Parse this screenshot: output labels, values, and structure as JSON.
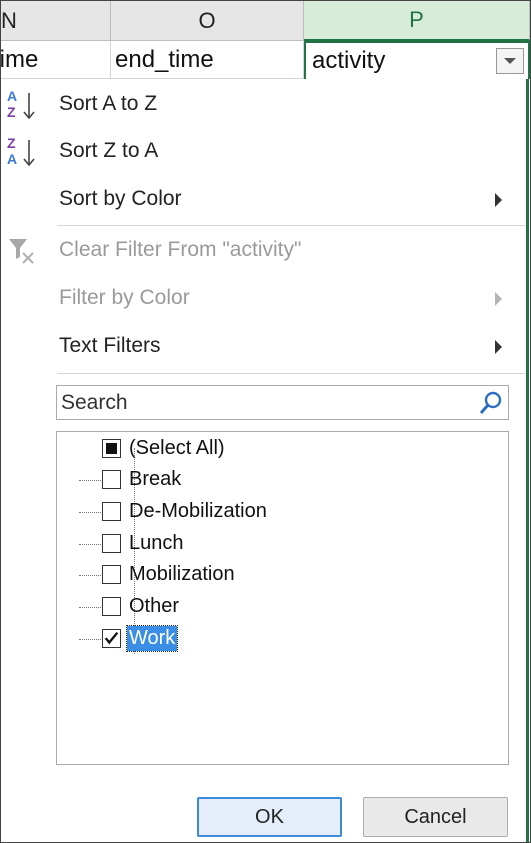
{
  "columns": [
    {
      "letter": "N",
      "header": "time"
    },
    {
      "letter": "O",
      "header": "end_time"
    },
    {
      "letter": "P",
      "header": "activity"
    }
  ],
  "menu": {
    "sort_az": "Sort A to Z",
    "sort_za": "Sort Z to A",
    "sort_by_color": "Sort by Color",
    "clear_filter": "Clear Filter From \"activity\"",
    "filter_by_color": "Filter by Color",
    "text_filters": "Text Filters"
  },
  "search": {
    "placeholder": "Search"
  },
  "filter_items": [
    {
      "label": "(Select All)",
      "state": "partial"
    },
    {
      "label": "Break",
      "state": "unchecked"
    },
    {
      "label": "De-Mobilization",
      "state": "unchecked"
    },
    {
      "label": "Lunch",
      "state": "unchecked"
    },
    {
      "label": "Mobilization",
      "state": "unchecked"
    },
    {
      "label": "Other",
      "state": "unchecked"
    },
    {
      "label": "Work",
      "state": "checked",
      "selected": true
    }
  ],
  "buttons": {
    "ok": "OK",
    "cancel": "Cancel"
  },
  "colors": {
    "accent_green": "#217346",
    "selection_blue": "#3a8ee6"
  }
}
